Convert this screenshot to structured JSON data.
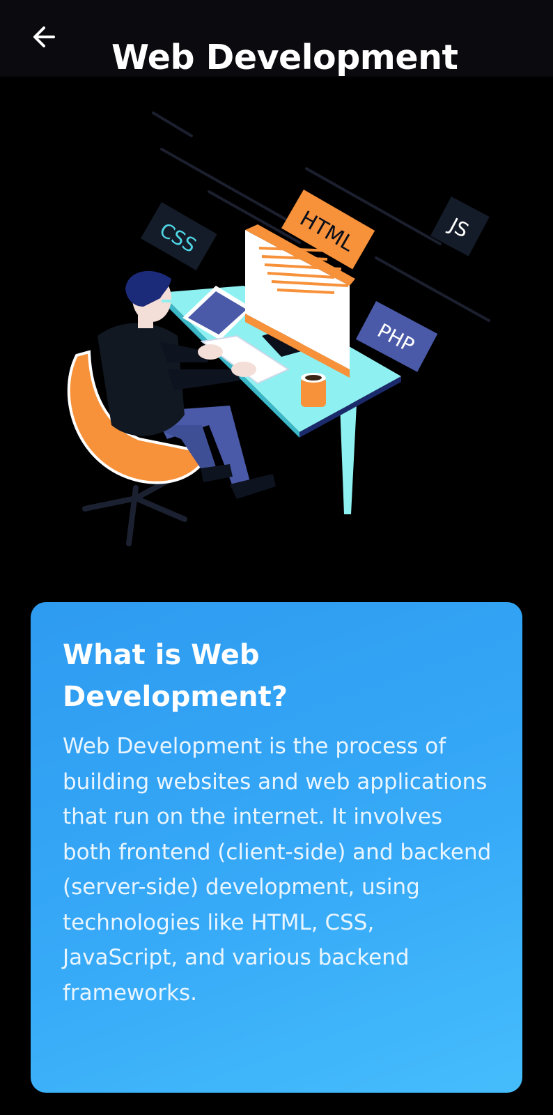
{
  "app_bar": {
    "title": "Web Development",
    "back_icon": "arrow-left-icon"
  },
  "hero": {
    "illustration": "developer-at-desk-illustration",
    "tags": {
      "css": "CSS",
      "html": "HTML",
      "js": "JS",
      "php": "PHP"
    }
  },
  "card": {
    "title": "What is Web Development?",
    "body": "Web Development is the process of building websites and web applications that run on the internet. It involves both frontend (client-side) and backend (server-side) development, using technologies like HTML, CSS, JavaScript, and various backend frameworks."
  },
  "colors": {
    "app_bar_bg": "#0a0a0f",
    "page_bg": "#000000",
    "card_gradient_start": "#2e9bf0",
    "card_gradient_end": "#45bdfc",
    "accent_orange": "#f7913a",
    "accent_cyan": "#8ef0f0",
    "accent_navy": "#4a5aa8"
  }
}
